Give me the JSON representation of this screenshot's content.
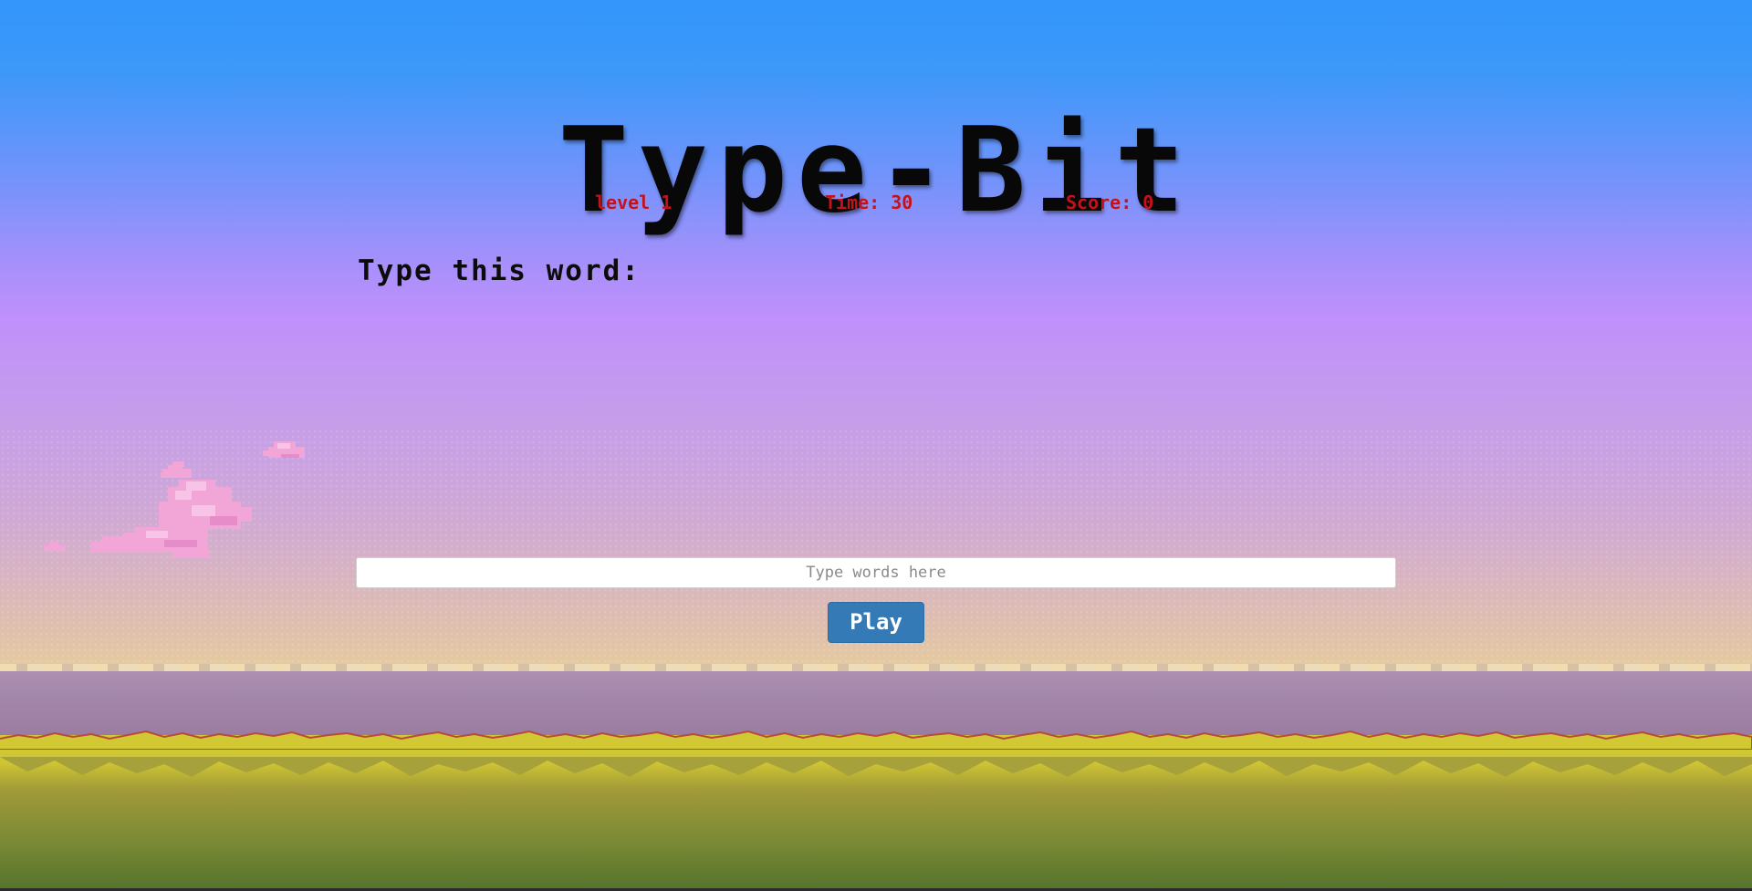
{
  "game": {
    "title": "Type-Bit"
  },
  "stats": {
    "level_label": "level 1",
    "time_label": "Time: 30",
    "score_label": "Score: 0"
  },
  "prompt": {
    "label": "Type this word:",
    "current_word": ""
  },
  "input": {
    "placeholder": "Type words here",
    "value": ""
  },
  "controls": {
    "play_label": "Play"
  },
  "colors": {
    "stat_text": "#c5121a",
    "play_button": "#337ab7",
    "sky_top": "#3396fb",
    "sky_mid": "#c090fb",
    "grass": "#d2c834"
  }
}
